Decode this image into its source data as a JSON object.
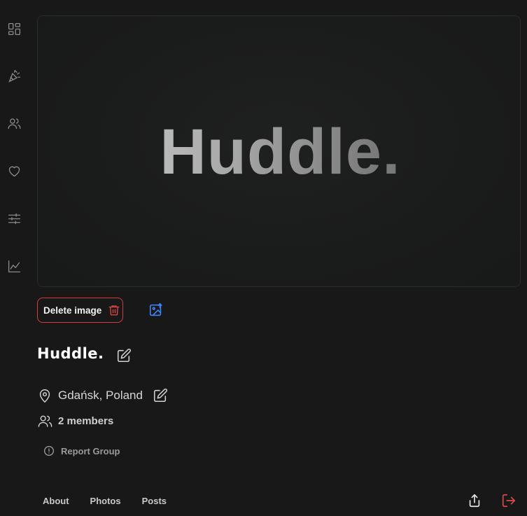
{
  "sidebar": {
    "items": [
      {
        "icon": "dashboard-icon"
      },
      {
        "icon": "party-popper-icon"
      },
      {
        "icon": "users-icon"
      },
      {
        "icon": "heart-icon"
      },
      {
        "icon": "sliders-icon"
      },
      {
        "icon": "chart-icon"
      }
    ]
  },
  "cover": {
    "text": "Huddle."
  },
  "image_actions": {
    "delete_label": "Delete image",
    "delete_icon": "trash-icon",
    "upload_icon": "image-upload-icon"
  },
  "group": {
    "title": "Huddle.",
    "location": "Gdańsk, Poland",
    "members": "2 members",
    "report_label": "Report Group"
  },
  "tabs": [
    {
      "label": "About"
    },
    {
      "label": "Photos"
    },
    {
      "label": "Posts"
    }
  ],
  "actions": {
    "share_icon": "share-icon",
    "leave_icon": "logout-icon"
  },
  "colors": {
    "background": "#181818",
    "danger": "#d43b3b",
    "accent": "#3b82f6",
    "icon_muted": "#8a8a8a"
  }
}
